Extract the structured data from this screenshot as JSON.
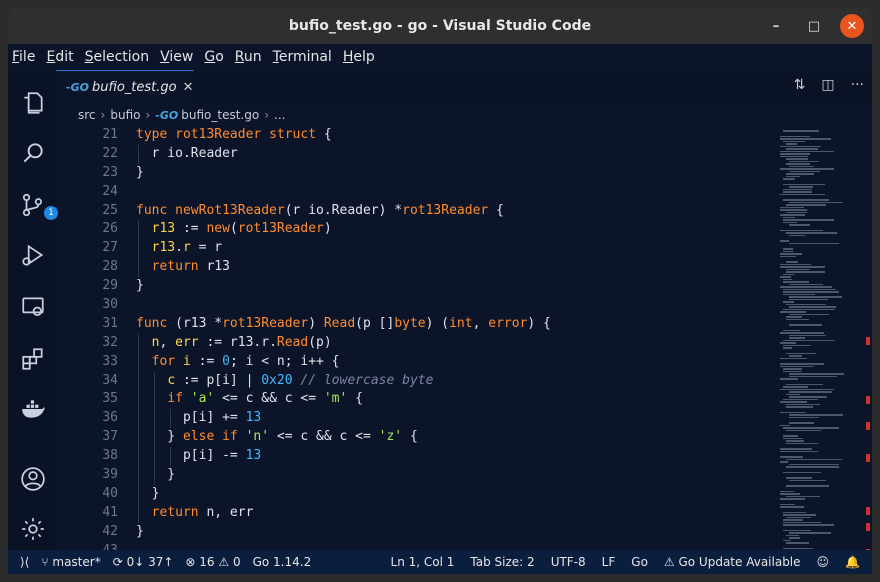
{
  "window": {
    "title": "bufio_test.go - go - Visual Studio Code",
    "controls": {
      "minimize": "–",
      "maximize": "□",
      "close": "✕"
    }
  },
  "menu": [
    "File",
    "Edit",
    "Selection",
    "View",
    "Go",
    "Run",
    "Terminal",
    "Help"
  ],
  "activity_bar": {
    "scm_badge": "1",
    "icons": [
      "files-icon",
      "search-icon",
      "source-control-icon",
      "run-debug-icon",
      "remote-explorer-icon",
      "extensions-icon",
      "docker-icon",
      "account-icon",
      "settings-gear-icon"
    ]
  },
  "tab": {
    "icon": "-GO",
    "label": "bufio_test.go",
    "close": "✕"
  },
  "breadcrumb": [
    "src",
    "bufio",
    "bufio_test.go",
    "..."
  ],
  "code_lines": [
    {
      "n": "21",
      "html": "<span class=\"kw\">type</span> <span class=\"ty\">rot13Reader</span> <span class=\"kw\">struct</span> {"
    },
    {
      "n": "22",
      "html": "  r io.Reader"
    },
    {
      "n": "23",
      "html": "}"
    },
    {
      "n": "24",
      "html": ""
    },
    {
      "n": "25",
      "html": "<span class=\"kw\">func</span> <span class=\"fn\">newRot13Reader</span>(r io.Reader) *<span class=\"ty\">rot13Reader</span> {"
    },
    {
      "n": "26",
      "html": "  <span class=\"vr\">r13</span> := <span class=\"fn\">new</span>(<span class=\"ty\">rot13Reader</span>)"
    },
    {
      "n": "27",
      "html": "  <span class=\"vr\">r13</span>.<span class=\"vr\">r</span> = r"
    },
    {
      "n": "28",
      "html": "  <span class=\"kw\">return</span> r13"
    },
    {
      "n": "29",
      "html": "}"
    },
    {
      "n": "30",
      "html": ""
    },
    {
      "n": "31",
      "html": "<span class=\"kw\">func</span> (r13 *<span class=\"ty\">rot13Reader</span>) <span class=\"fn\">Read</span>(p []<span class=\"ty\">byte</span>) (<span class=\"ty\">int</span>, <span class=\"ty\">error</span>) {"
    },
    {
      "n": "32",
      "html": "  <span class=\"vr\">n</span>, <span class=\"vr\">err</span> := r13.r.<span class=\"fn\">Read</span>(p)"
    },
    {
      "n": "33",
      "html": "  <span class=\"kw\">for</span> <span class=\"vr\">i</span> := <span class=\"num\">0</span>; i &lt; n; i++ {"
    },
    {
      "n": "34",
      "html": "    <span class=\"vr\">c</span> := p[i] | <span class=\"num\">0x20</span> <span class=\"cmt\">// lowercase byte</span>"
    },
    {
      "n": "35",
      "html": "    <span class=\"kw\">if</span> <span class=\"str\">'a'</span> &lt;= c &amp;&amp; c &lt;= <span class=\"str\">'m'</span> {"
    },
    {
      "n": "36",
      "html": "      p[i] += <span class=\"num\">13</span>"
    },
    {
      "n": "37",
      "html": "    } <span class=\"kw\">else if</span> <span class=\"str\">'n'</span> &lt;= c &amp;&amp; c &lt;= <span class=\"str\">'z'</span> {"
    },
    {
      "n": "38",
      "html": "      p[i] -= <span class=\"num\">13</span>"
    },
    {
      "n": "39",
      "html": "    }"
    },
    {
      "n": "40",
      "html": "  }"
    },
    {
      "n": "41",
      "html": "  <span class=\"kw\">return</span> n, err"
    },
    {
      "n": "42",
      "html": "}"
    },
    {
      "n": "43",
      "html": ""
    }
  ],
  "status": {
    "remote": "⟩⟨",
    "branch": "master*",
    "sync": "0↓ 37↑",
    "problems": "⊗ 16 ⚠ 0",
    "go_version": "Go 1.14.2",
    "position": "Ln 1, Col 1",
    "tab_size": "Tab Size: 2",
    "encoding": "UTF-8",
    "eol": "LF",
    "language": "Go",
    "update": "⚠ Go Update Available"
  },
  "colors": {
    "background": "#0b1428",
    "keyword": "#ff8c2e",
    "number": "#3fb9ff",
    "string": "#a5e65a",
    "variable": "#ffd64a",
    "statusbar": "#0b1e3e"
  }
}
